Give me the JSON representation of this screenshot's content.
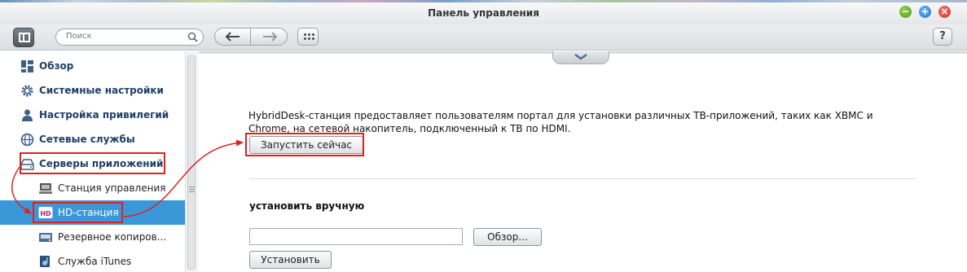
{
  "window": {
    "title": "Панель управления"
  },
  "toolbar": {
    "search_placeholder": "Поиск",
    "help_label": "?"
  },
  "sidebar": {
    "items": [
      {
        "label": "Обзор",
        "icon": "overview-icon"
      },
      {
        "label": "Системные настройки",
        "icon": "gear-icon"
      },
      {
        "label": "Настройка привилегий",
        "icon": "user-icon"
      },
      {
        "label": "Сетевые службы",
        "icon": "globe-icon"
      },
      {
        "label": "Серверы приложений",
        "icon": "drive-icon"
      }
    ],
    "subitems": [
      {
        "label": "Станция управления",
        "icon": "station-icon"
      },
      {
        "label": "HD-станция",
        "icon": "hd-station-icon",
        "active": true
      },
      {
        "label": "Резервное копиров...",
        "icon": "backup-icon"
      },
      {
        "label": "Служба iTunes",
        "icon": "itunes-icon"
      }
    ]
  },
  "main": {
    "description_line1": "HybridDesk-станция предоставляет пользователям портал для установки различных ТВ-приложений, таких как XBMC и",
    "description_line2": "Chrome, на сетевой накопитель, подключенный к ТВ по HDMI.",
    "launch_button": "Запустить сейчас",
    "manual_title": "установить вручную",
    "browse_button": "Обзор...",
    "install_button": "Установить",
    "file_value": ""
  },
  "colors": {
    "accent_active": "#3a98d8",
    "annotation_red": "#e02020",
    "sidebar_text": "#1f3f66"
  }
}
